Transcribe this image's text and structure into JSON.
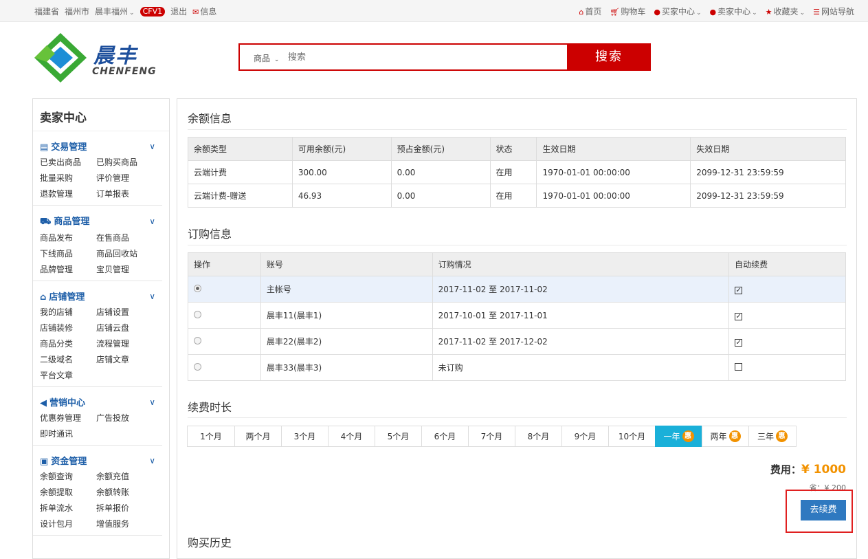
{
  "topbar": {
    "province": "福建省",
    "city": "福州市",
    "shop": "晨丰福州",
    "badge": "CFV1",
    "logout": "退出",
    "messages": "信息",
    "home": "首页",
    "cart": "购物车",
    "buyer_center": "买家中心",
    "seller_center": "卖家中心",
    "favorites": "收藏夹",
    "site_nav": "网站导航"
  },
  "logo": {
    "name": "晨丰",
    "sub": "CHENFENG"
  },
  "search": {
    "category": "商品",
    "placeholder": "搜索",
    "button": "搜索"
  },
  "sidebar": {
    "title": "卖家中心",
    "sections": [
      {
        "title": "交易管理",
        "links": [
          "已卖出商品",
          "已购买商品",
          "批量采购",
          "评价管理",
          "退款管理",
          "订单报表"
        ]
      },
      {
        "title": "商品管理",
        "links": [
          "商品发布",
          "在售商品",
          "下线商品",
          "商品回收站",
          "品牌管理",
          "宝贝管理"
        ]
      },
      {
        "title": "店铺管理",
        "links": [
          "我的店铺",
          "店铺设置",
          "店铺装修",
          "店铺云盘",
          "商品分类",
          "流程管理",
          "二级域名",
          "店铺文章",
          "平台文章"
        ]
      },
      {
        "title": "营销中心",
        "links": [
          "优惠券管理",
          "广告投放",
          "即时通讯"
        ]
      },
      {
        "title": "资金管理",
        "links": [
          "余额查询",
          "余额充值",
          "余额提取",
          "余额转账",
          "拆单流水",
          "拆单报价",
          "设计包月",
          "增值服务"
        ]
      }
    ]
  },
  "balance": {
    "title": "余额信息",
    "headers": [
      "余额类型",
      "可用余额(元)",
      "预占金额(元)",
      "状态",
      "生效日期",
      "失效日期"
    ],
    "rows": [
      [
        "云端计费",
        "300.00",
        "0.00",
        "在用",
        "1970-01-01 00:00:00",
        "2099-12-31 23:59:59"
      ],
      [
        "云端计费-赠送",
        "46.93",
        "0.00",
        "在用",
        "1970-01-01 00:00:00",
        "2099-12-31 23:59:59"
      ]
    ]
  },
  "orders": {
    "title": "订购信息",
    "headers": [
      "操作",
      "账号",
      "订购情况",
      "自动续费"
    ],
    "rows": [
      {
        "account": "主帐号",
        "status": "2017-11-02 至 2017-11-02",
        "selected": true,
        "auto": true
      },
      {
        "account": "晨丰11(晨丰1)",
        "status": "2017-10-01 至 2017-11-01",
        "selected": false,
        "auto": true
      },
      {
        "account": "晨丰22(晨丰2)",
        "status": "2017-11-02 至 2017-12-02",
        "selected": false,
        "auto": true
      },
      {
        "account": "晨丰33(晨丰3)",
        "status": "未订购",
        "selected": false,
        "auto": false
      }
    ]
  },
  "duration": {
    "title": "续费时长",
    "options": [
      "1个月",
      "两个月",
      "3个月",
      "4个月",
      "5个月",
      "6个月",
      "7个月",
      "8个月",
      "9个月",
      "10个月",
      "一年",
      "两年",
      "三年"
    ],
    "selected": "一年",
    "discount_mark": "惠"
  },
  "fee": {
    "label": "费用：",
    "amount": "¥ 1000",
    "save": "省：¥ 200",
    "button": "去续费"
  },
  "history": {
    "title": "购买历史"
  }
}
